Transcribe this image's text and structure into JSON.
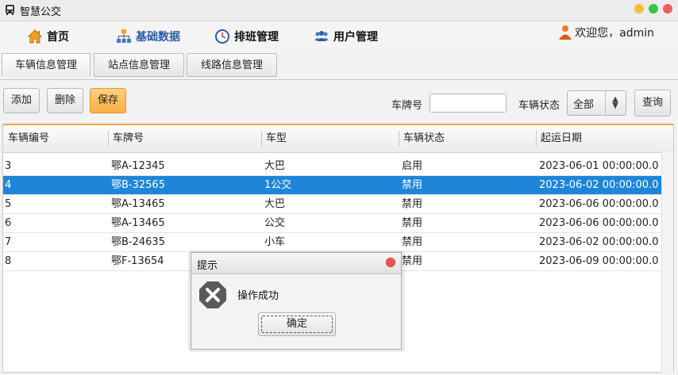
{
  "window": {
    "title": "智慧公交",
    "controls": [
      {
        "name": "minimize",
        "color": "#f6bc3e"
      },
      {
        "name": "maximize",
        "color": "#33c748"
      },
      {
        "name": "close",
        "color": "#f25b57"
      }
    ]
  },
  "nav": {
    "items": [
      {
        "label": "首页",
        "icon": "home-icon"
      },
      {
        "label": "基础数据",
        "icon": "sitemap-icon"
      },
      {
        "label": "排班管理",
        "icon": "clock-icon"
      },
      {
        "label": "用户管理",
        "icon": "users-icon"
      }
    ],
    "active_index": 1,
    "welcome": "欢迎您，admin"
  },
  "subtabs": [
    "车辆信息管理",
    "站点信息管理",
    "线路信息管理"
  ],
  "toolbar": {
    "add_label": "添加",
    "delete_label": "删除",
    "save_label": "保存",
    "plate_label": "车牌号",
    "plate_value": "",
    "status_label": "车辆状态",
    "status_value": "全部",
    "query_label": "查询"
  },
  "table": {
    "headers": [
      "车辆编号",
      "车牌号",
      "车型",
      "车辆状态",
      "起运日期"
    ],
    "rows": [
      [
        "3",
        "鄂A-12345",
        "大巴",
        "启用",
        "2023-06-01 00:00:00.0"
      ],
      [
        "4",
        "鄂B-32565",
        "1公交",
        "禁用",
        "2023-06-02 00:00:00.0"
      ],
      [
        "5",
        "鄂A-13465",
        "大巴",
        "禁用",
        "2023-06-06 00:00:00.0"
      ],
      [
        "6",
        "鄂A-13465",
        "公交",
        "禁用",
        "2023-06-06 00:00:00.0"
      ],
      [
        "7",
        "鄂B-24635",
        "小车",
        "禁用",
        "2023-06-02 00:00:00.0"
      ],
      [
        "8",
        "鄂F-13654",
        "",
        "禁用",
        "2023-06-09 00:00:00.0"
      ]
    ],
    "selected_row": 1,
    "selection_color": "#1d86d8"
  },
  "dialog": {
    "title": "提示",
    "message": "操作成功",
    "ok_label": "确定",
    "icon": "error-x-icon"
  },
  "colors": {
    "accent": "#f7b041",
    "nav_active": "#2a5aa8"
  }
}
